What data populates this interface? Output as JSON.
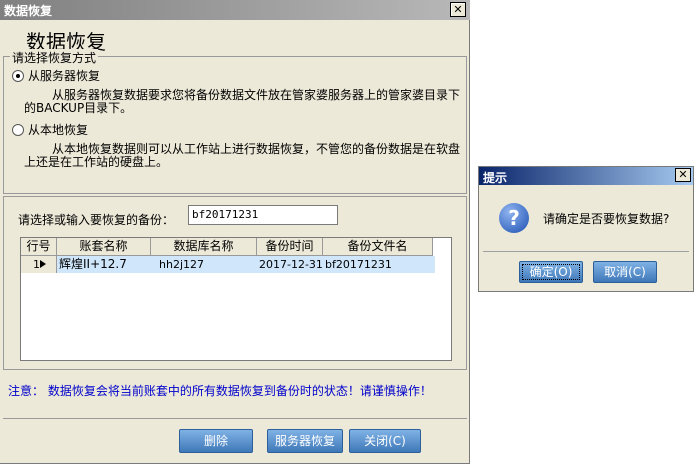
{
  "main_window": {
    "title": "数据恢复",
    "close_glyph": "✕",
    "page_title": "数据恢复",
    "restore_group": {
      "legend": "请选择恢复方式",
      "options": [
        {
          "label": "从服务器恢复",
          "checked": true,
          "description": "从服务器恢复数据要求您将备份数据文件放在管家婆服务器上的管家婆目录下的BACKUP目录下。"
        },
        {
          "label": "从本地恢复",
          "checked": false,
          "description": "从本地恢复数据则可以从工作站上进行数据恢复，不管您的备份数据是在软盘上还是在工作站的硬盘上。"
        }
      ]
    },
    "backup_select": {
      "label": "请选择或输入要恢复的备份：",
      "value": "bf20171231"
    },
    "table": {
      "columns": [
        "行号",
        "账套名称",
        "数据库名称",
        "备份时间",
        "备份文件名"
      ],
      "rows": [
        {
          "row_no": "1",
          "account_set": "辉煌II+12.7",
          "database": "hh2j127",
          "backup_time": "2017-12-31",
          "backup_file": "bf20171231",
          "selected": true
        }
      ]
    },
    "warning": "注意：  数据恢复会将当前账套中的所有数据恢复到备份时的状态！请谨慎操作！",
    "buttons": {
      "delete": "删除",
      "server_restore": "服务器恢复",
      "close": "关闭(C)"
    }
  },
  "prompt_dialog": {
    "title": "提示",
    "close_glyph": "✕",
    "icon": "question-icon",
    "message": "请确定是否要恢复数据?",
    "ok": "确定(O)",
    "cancel": "取消(C)"
  }
}
